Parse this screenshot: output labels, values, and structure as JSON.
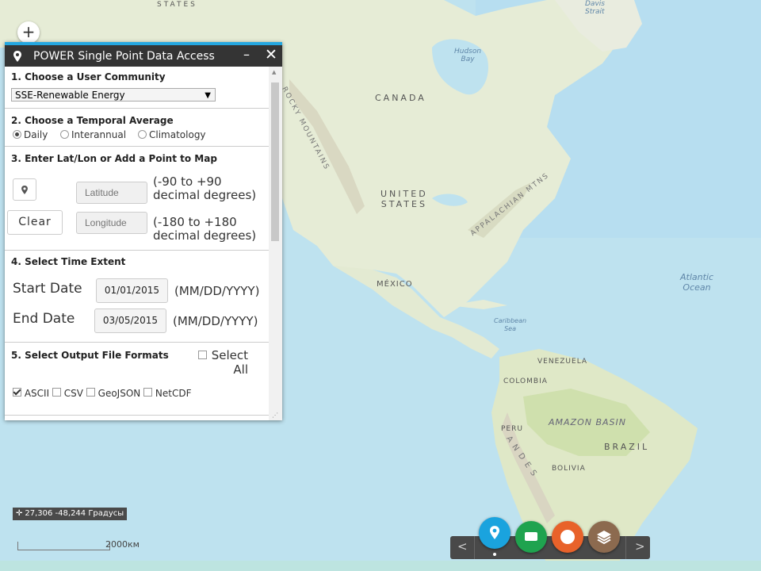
{
  "map": {
    "labels": [
      {
        "name": "states-partial-label",
        "text": "STATES"
      },
      {
        "name": "strait-label",
        "text": "Davis\nStrait"
      },
      {
        "name": "hudson-bay-label",
        "text": "Hudson\nBay"
      },
      {
        "name": "canada-label",
        "text": "CANADA"
      },
      {
        "name": "rocky-mountains-label",
        "text": "ROCKY MOUNTAINS"
      },
      {
        "name": "united-states-label",
        "text": "UNITED\nSTATES"
      },
      {
        "name": "appalachian-label",
        "text": "APPALACHIAN MTNS"
      },
      {
        "name": "mexico-label",
        "text": "MÉXICO"
      },
      {
        "name": "atlantic-label",
        "text": "Atlantic\nOcean"
      },
      {
        "name": "caribbean-label",
        "text": "Caribbean\nSea"
      },
      {
        "name": "venezuela-label",
        "text": "VENEZUELA"
      },
      {
        "name": "colombia-label",
        "text": "COLOMBIA"
      },
      {
        "name": "amazon-label",
        "text": "AMAZON BASIN"
      },
      {
        "name": "peru-label",
        "text": "PERU"
      },
      {
        "name": "brazil-label",
        "text": "BRAZIL"
      },
      {
        "name": "andes-label",
        "text": "ANDES"
      },
      {
        "name": "bolivia-label",
        "text": "BOLIVIA"
      }
    ],
    "zoom_in": "+",
    "coords": "27,306 -48,244 Градусы",
    "scale": "2000км"
  },
  "panel": {
    "title": "POWER Single Point Data Access",
    "minimize": "–",
    "close": "✕",
    "s1": {
      "title": "1. Choose a User Community",
      "selected": "SSE-Renewable Energy"
    },
    "s2": {
      "title": "2. Choose a Temporal Average",
      "options": [
        "Daily",
        "Interannual",
        "Climatology"
      ],
      "selected": "Daily"
    },
    "s3": {
      "title": "3. Enter Lat/Lon or Add a Point to Map",
      "clear": "Clear",
      "lat_placeholder": "Latitude",
      "lon_placeholder": "Longitude",
      "lat_hint": "(-90 to +90\ndecimal degrees)",
      "lon_hint": "(-180 to +180\ndecimal degrees)"
    },
    "s4": {
      "title": "4. Select Time Extent",
      "start_label": "Start Date",
      "start_value": "01/01/2015",
      "end_label": "End Date",
      "end_value": "03/05/2015",
      "format": "(MM/DD/YYYY)"
    },
    "s5": {
      "title": "5. Select Output File Formats",
      "select_all": "Select\nAll",
      "formats": [
        {
          "label": "ASCII",
          "checked": true
        },
        {
          "label": "CSV",
          "checked": false
        },
        {
          "label": "GeoJSON",
          "checked": false
        },
        {
          "label": "NetCDF",
          "checked": false
        }
      ]
    }
  },
  "toolbar": {
    "prev": "<",
    "next": ">",
    "colors": {
      "pin": "#1aa3de",
      "comment": "#1fa34f",
      "circle": "#e8622a",
      "layers": "#8c6a4f"
    }
  }
}
